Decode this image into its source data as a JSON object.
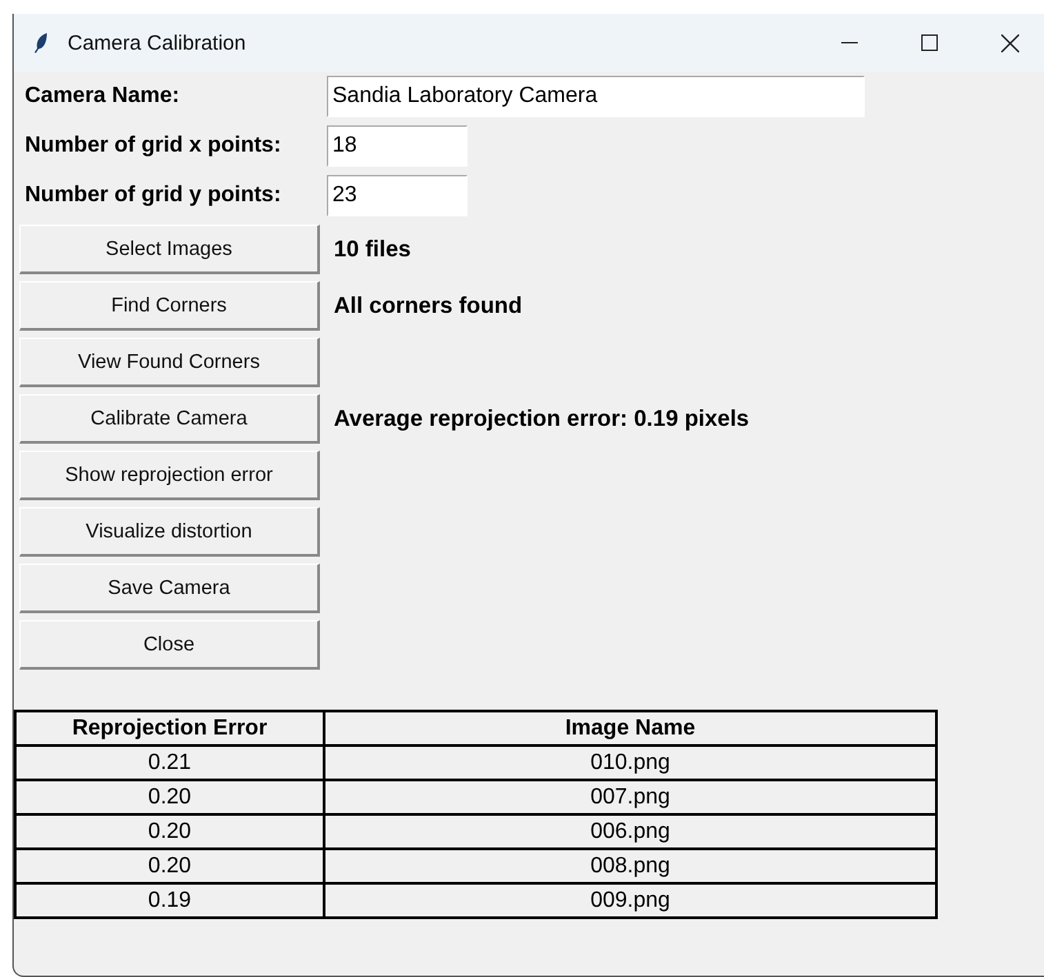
{
  "window": {
    "title": "Camera Calibration"
  },
  "fields": [
    {
      "label": "Camera Name:",
      "value": "Sandia Laboratory Camera",
      "kind": "wide"
    },
    {
      "label": "Number of grid x points:",
      "value": "18",
      "kind": "narrow"
    },
    {
      "label": "Number of grid y points:",
      "value": "23",
      "kind": "narrow"
    }
  ],
  "actions": [
    {
      "button": "Select Images",
      "status": "10 files"
    },
    {
      "button": "Find Corners",
      "status": "All corners found"
    },
    {
      "button": "View Found Corners"
    },
    {
      "button": "Calibrate Camera",
      "status": "Average reprojection error: 0.19 pixels"
    },
    {
      "button": "Show reprojection error"
    },
    {
      "button": "Visualize distortion"
    },
    {
      "button": "Save Camera"
    },
    {
      "button": "Close"
    }
  ],
  "table": {
    "columns": [
      "Reprojection Error",
      "Image Name"
    ],
    "rows": [
      [
        "0.21",
        "010.png"
      ],
      [
        "0.20",
        "007.png"
      ],
      [
        "0.20",
        "006.png"
      ],
      [
        "0.20",
        "008.png"
      ],
      [
        "0.19",
        "009.png"
      ]
    ]
  }
}
